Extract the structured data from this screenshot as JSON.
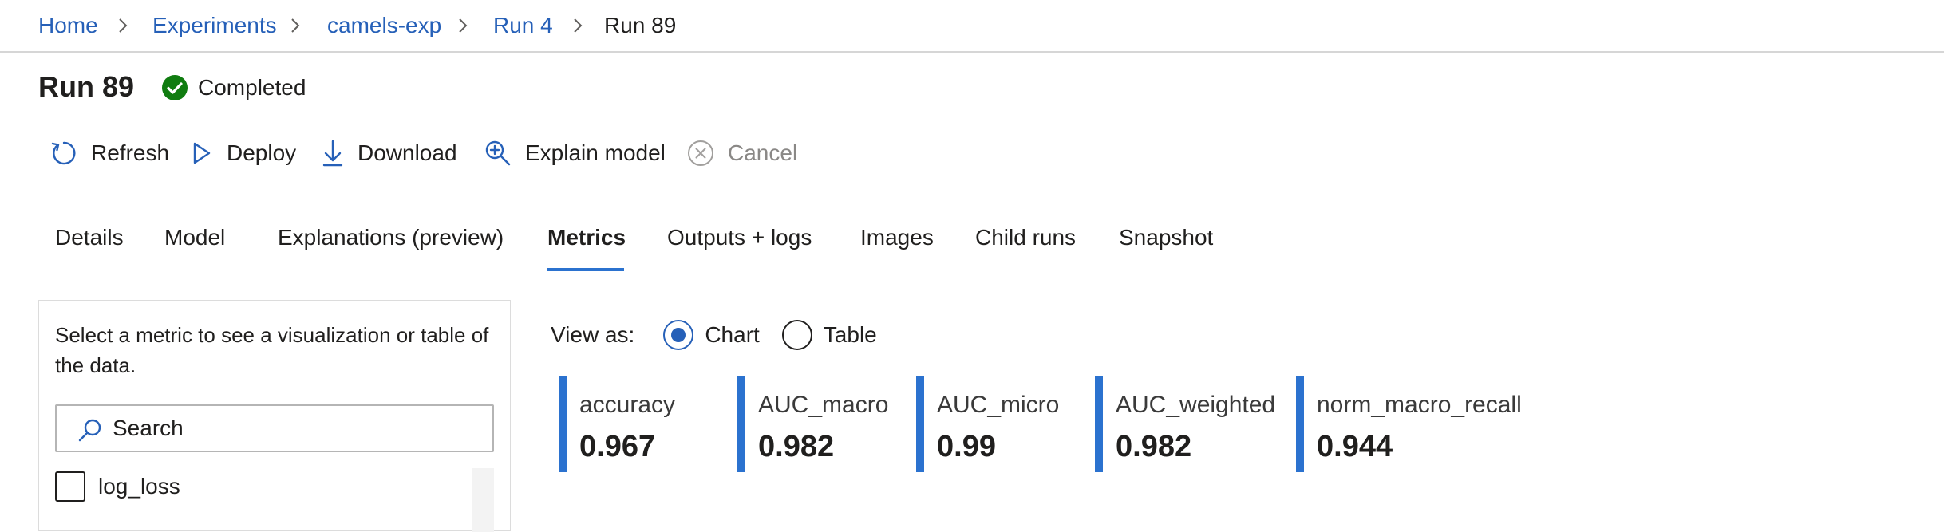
{
  "breadcrumb": {
    "items": [
      {
        "label": "Home"
      },
      {
        "label": "Experiments"
      },
      {
        "label": "camels-exp"
      },
      {
        "label": "Run 4"
      },
      {
        "label": "Run 89"
      }
    ]
  },
  "header": {
    "title": "Run 89",
    "status": {
      "label": "Completed",
      "icon": "check-circle-icon",
      "color": "#107c10"
    }
  },
  "toolbar": {
    "refresh": {
      "label": "Refresh",
      "icon": "refresh-icon"
    },
    "deploy": {
      "label": "Deploy",
      "icon": "play-icon"
    },
    "download": {
      "label": "Download",
      "icon": "download-icon"
    },
    "explain": {
      "label": "Explain model",
      "icon": "zoom-in-icon"
    },
    "cancel": {
      "label": "Cancel",
      "icon": "close-circle-icon",
      "disabled": true
    }
  },
  "tabs": [
    {
      "label": "Details"
    },
    {
      "label": "Model"
    },
    {
      "label": "Explanations (preview)"
    },
    {
      "label": "Metrics",
      "active": true
    },
    {
      "label": "Outputs + logs"
    },
    {
      "label": "Images"
    },
    {
      "label": "Child runs"
    },
    {
      "label": "Snapshot"
    }
  ],
  "metrics_panel": {
    "description": "Select a metric to see a visualization or table of the data.",
    "search": {
      "placeholder": "Search",
      "value": ""
    },
    "items": [
      {
        "label": "log_loss",
        "checked": false
      }
    ]
  },
  "view_as": {
    "label": "View as:",
    "options": [
      {
        "label": "Chart",
        "selected": true
      },
      {
        "label": "Table",
        "selected": false
      }
    ]
  },
  "metric_cards": [
    {
      "name": "accuracy",
      "value": "0.967"
    },
    {
      "name": "AUC_macro",
      "value": "0.982"
    },
    {
      "name": "AUC_micro",
      "value": "0.99"
    },
    {
      "name": "AUC_weighted",
      "value": "0.982"
    },
    {
      "name": "norm_macro_recall",
      "value": "0.944"
    }
  ],
  "colors": {
    "accent": "#2b72cf",
    "link": "#2660b8",
    "success": "#107c10",
    "disabled": "#8a8886"
  }
}
